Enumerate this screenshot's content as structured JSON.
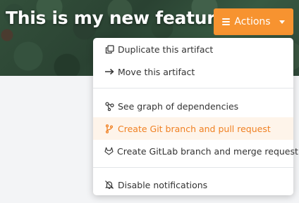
{
  "header": {
    "title": "This is my new feature",
    "actions_label": "Actions"
  },
  "menu": {
    "items": [
      {
        "label": "Duplicate this artifact",
        "icon": "copy-icon"
      },
      {
        "label": "Move this artifact",
        "icon": "arrow-right-icon"
      },
      {
        "label": "See graph of dependencies",
        "icon": "graph-icon"
      },
      {
        "label": "Create Git branch and pull request",
        "icon": "git-branch-icon"
      },
      {
        "label": "Create GitLab branch and merge request",
        "icon": "gitlab-icon"
      },
      {
        "label": "Disable notifications",
        "icon": "bell-slash-icon"
      }
    ]
  },
  "colors": {
    "accent": "#f79330",
    "highlight_bg": "#fef4ea",
    "highlight_text": "#f08022"
  }
}
